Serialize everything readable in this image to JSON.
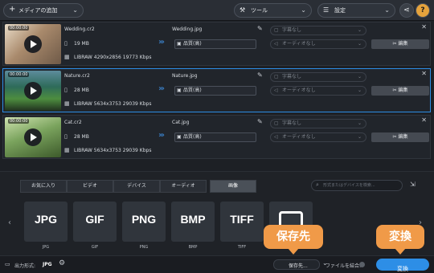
{
  "toolbar": {
    "add_media": "メディアの追加",
    "tools": "ツール",
    "settings": "設定"
  },
  "files": [
    {
      "time": "00:00:00",
      "name": "Wedding.cr2",
      "size": "19 MB",
      "meta": "LIBRAW 4290x2856 19773 Kbps",
      "out_name": "Wedding.jpg",
      "quality": "品質(高)",
      "subtitle": "字幕なし",
      "audio": "オーディオなし",
      "edit": "編集"
    },
    {
      "time": "00:00:00",
      "name": "Nature.cr2",
      "size": "28 MB",
      "meta": "LIBRAW 5634x3753 29039 Kbps",
      "out_name": "Nature.jpg",
      "quality": "品質(高)",
      "subtitle": "字幕なし",
      "audio": "オーディオなし",
      "edit": "編集"
    },
    {
      "time": "00:00:00",
      "name": "Cat.cr2",
      "size": "28 MB",
      "meta": "LIBRAW 5634x3753 29039 Kbps",
      "out_name": "Cat.jpg",
      "quality": "品質(高)",
      "subtitle": "字幕なし",
      "audio": "オーディオなし",
      "edit": "編集"
    }
  ],
  "tabs": [
    "お気に入り",
    "ビデオ",
    "デバイス",
    "オーディオ",
    "画像"
  ],
  "search_placeholder": "形式またはデバイスを検索...",
  "formats": [
    {
      "label": "JPG",
      "caption": "JPG"
    },
    {
      "label": "GIF",
      "caption": "GIF"
    },
    {
      "label": "PNG",
      "caption": "PNG"
    },
    {
      "label": "BMP",
      "caption": "BMP"
    },
    {
      "label": "TIFF",
      "caption": "TIFF"
    },
    {
      "label": "",
      "caption": ""
    }
  ],
  "bottom": {
    "output_format_label": "出力形式:",
    "output_format_value": "JPG",
    "save_to": "保存先...",
    "merge_files": "ファイルを結合:",
    "convert": "変換"
  },
  "overlays": {
    "save_callout": "保存先",
    "convert_callout": "変換"
  },
  "colors": {
    "accent": "#2d8ee6",
    "callout": "#f09a48"
  }
}
